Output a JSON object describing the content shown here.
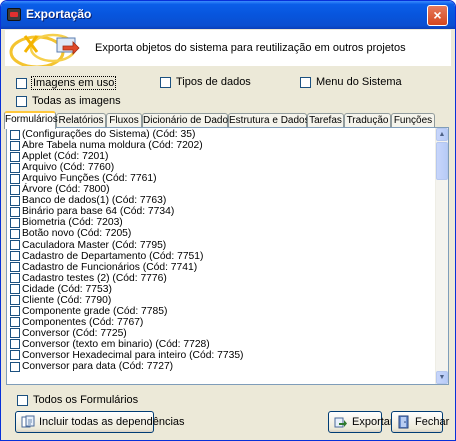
{
  "window": {
    "title": "Exportação",
    "close_glyph": "×"
  },
  "header": {
    "description": "Exporta objetos do sistema para reutilização em outros projetos"
  },
  "options": {
    "imagens_em_uso": "Imagens em uso",
    "tipos_de_dados": "Tipos de dados",
    "menu_do_sistema": "Menu do Sistema",
    "todas_as_imagens": "Todas as imagens"
  },
  "tabs": [
    {
      "label": "Formulários",
      "active": true
    },
    {
      "label": "Relatórios",
      "active": false
    },
    {
      "label": "Fluxos",
      "active": false
    },
    {
      "label": "Dicionário de Dados",
      "active": false
    },
    {
      "label": "Estrutura e Dados",
      "active": false
    },
    {
      "label": "Tarefas",
      "active": false
    },
    {
      "label": "Tradução",
      "active": false
    },
    {
      "label": "Funções",
      "active": false
    }
  ],
  "list": {
    "items": [
      "(Configurações do Sistema) (Cód: 35)",
      "Abre Tabela numa moldura (Cód: 7202)",
      "Applet (Cód: 7201)",
      "Arquivo (Cód: 7760)",
      "Arquivo Funções (Cód: 7761)",
      "Árvore (Cód: 7800)",
      "Banco de dados(1) (Cód: 7763)",
      "Binário para base 64 (Cód: 7734)",
      "Biometria (Cód: 7203)",
      "Botão novo (Cód: 7205)",
      "Caculadora Master (Cód: 7795)",
      "Cadastro de Departamento (Cód: 7751)",
      "Cadastro de Funcionários (Cód: 7741)",
      "Cadastro testes (2) (Cód: 7776)",
      "Cidade (Cód: 7753)",
      "Cliente (Cód: 7790)",
      "Componente grade (Cód: 7785)",
      "Componentes (Cód: 7767)",
      "Conversor (Cód: 7725)",
      "Conversor (texto em binario) (Cód: 7728)",
      "Conversor Hexadecimal para inteiro (Cód: 7735)",
      "Conversor para data (Cód: 7727)"
    ]
  },
  "footer": {
    "todos_label": "Todos os Formulários",
    "incluir_label": "Incluir todas as dependências",
    "exportar_label": "Exportar",
    "fechar_label": "Fechar"
  },
  "icons": {
    "title": "app-icon",
    "header": "export-logo-icon",
    "incluir": "dependencies-icon",
    "exportar": "export-icon",
    "fechar": "exit-door-icon",
    "scroll_up": "arrow-up-icon",
    "scroll_down": "arrow-down-icon"
  },
  "colors": {
    "titlebar": "#0855dd",
    "window_bg": "#ece9d8",
    "active_tab_accent": "#ffc83c",
    "close_button": "#d4461e"
  }
}
